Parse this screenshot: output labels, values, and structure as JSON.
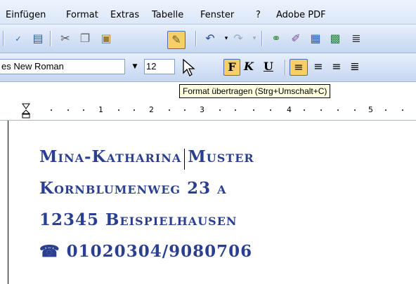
{
  "menu": {
    "items": [
      {
        "label": "Einfügen"
      },
      {
        "label": "Format"
      },
      {
        "label": "Extras"
      },
      {
        "label": "Tabelle"
      },
      {
        "label": "Fenster"
      },
      {
        "label": "?"
      },
      {
        "label": "Adobe PDF"
      }
    ]
  },
  "toolbar": {
    "standard_icons": [
      "spelling-icon",
      "research-icon",
      "cut-icon",
      "copy-icon",
      "paste-icon",
      "format-painter-icon",
      "undo-icon",
      "redo-icon",
      "hyperlink-icon",
      "tables-borders-icon",
      "insert-table-icon",
      "insert-excel-icon",
      "columns-icon"
    ],
    "font_name": "es New Roman",
    "font_size": "12",
    "bold_label": "F",
    "italic_label": "K",
    "underline_label": "U"
  },
  "tooltip": {
    "text": "Format übertragen (Strg+Umschalt+C)"
  },
  "ruler": {
    "numbers": [
      "1",
      "2",
      "3",
      "4",
      "5"
    ]
  },
  "document": {
    "lines": [
      {
        "text": "Mina-Katharina Muster"
      },
      {
        "text": "Kornblumenweg 23 a"
      },
      {
        "text": "12345 Beispielhausen"
      },
      {
        "text": "01020304/9080706"
      }
    ],
    "phone_icon": "telephone-icon",
    "text_color": "#2a3f8f"
  },
  "colors": {
    "highlight": "#f7cf68",
    "toolbar": "#d5e2f6"
  }
}
